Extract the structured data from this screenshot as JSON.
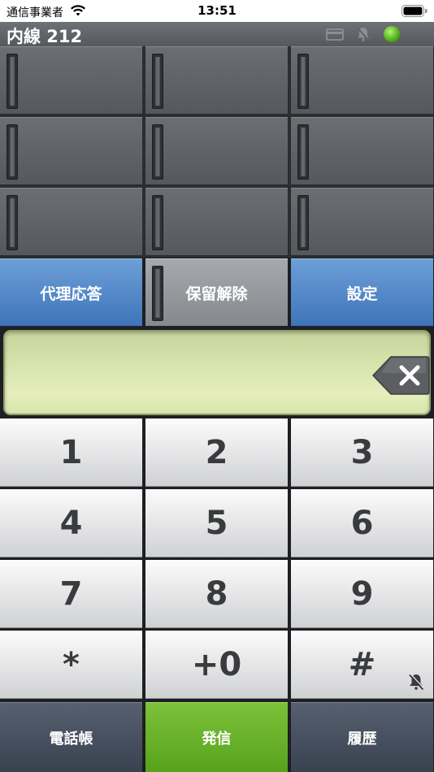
{
  "status_bar": {
    "carrier": "通信事業者",
    "time": "13:51"
  },
  "title_bar": {
    "title": "内線 212",
    "icons": [
      "card-icon",
      "bell-off-icon",
      "status-led-icon"
    ],
    "status_led_color": "#55b41e"
  },
  "line_keys": {
    "count": 9,
    "columns": 3,
    "rows": 3
  },
  "function_keys": {
    "pickup_label": "代理応答",
    "hold_release_label": "保留解除",
    "settings_label": "設定"
  },
  "display": {
    "value": "",
    "backspace_icon": "backspace-icon"
  },
  "keypad": {
    "keys": [
      "1",
      "2",
      "3",
      "4",
      "5",
      "6",
      "7",
      "8",
      "9",
      "*",
      "+0",
      "#"
    ],
    "mute_icon": "bell-off-icon"
  },
  "bottom_bar": {
    "phonebook_label": "電話帳",
    "call_label": "発信",
    "history_label": "履歴"
  },
  "colors": {
    "accent_blue": "#3e74ba",
    "call_green": "#58a31c",
    "display_bg": "#e6efbc"
  }
}
